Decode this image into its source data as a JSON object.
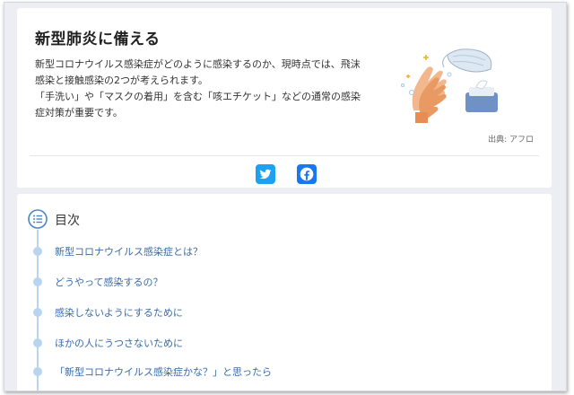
{
  "article": {
    "title": "新型肺炎に備える",
    "desc_line1": "新型コロナウイルス感染症がどのように感染するのか、現時点では、飛沫感染と接触感染の2つが考えられます。",
    "desc_line2": "「手洗い」や「マスクの着用」を含む「咳エチケット」などの通常の感染症対策が重要です。",
    "source": "出典: アフロ"
  },
  "share": {
    "twitter_icon": "twitter-icon",
    "facebook_icon": "facebook-icon",
    "twitter_color": "#1da1f2",
    "facebook_color": "#1877f2"
  },
  "toc": {
    "title": "目次",
    "icon": "list-icon",
    "accent": "#3b6ca8",
    "items": [
      "新型コロナウイルス感染症とは？",
      "どうやって感染するの？",
      "感染しないようにするために",
      "ほかの人にうつさないために",
      "「新型コロナウイルス感染症かな？」と思ったら"
    ]
  }
}
